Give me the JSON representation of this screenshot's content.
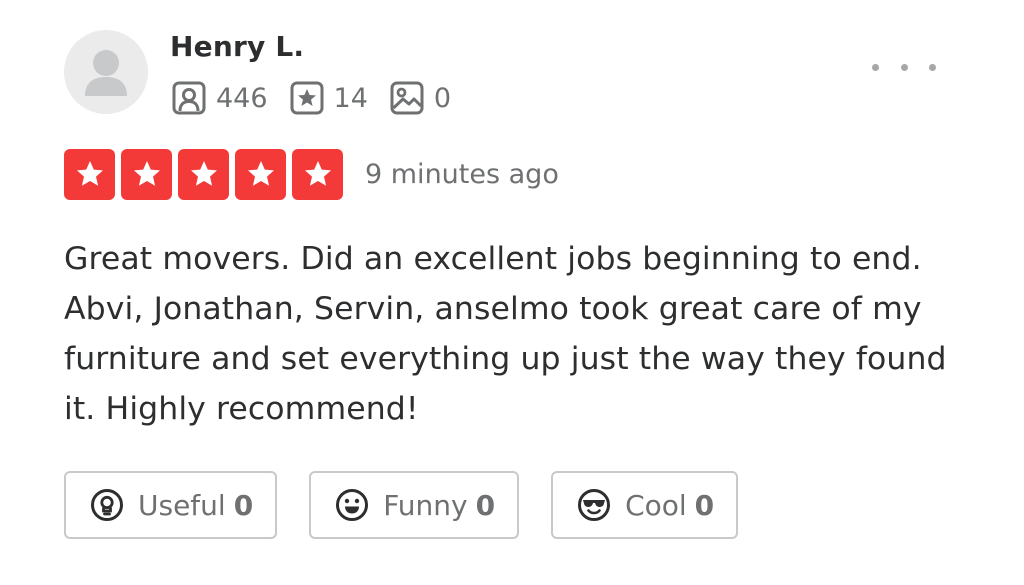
{
  "reviewer": {
    "name": "Henry L.",
    "stats": {
      "friends": "446",
      "reviews": "14",
      "photos": "0"
    },
    "icons": {
      "avatar": "default-user-avatar",
      "friends": "friends-icon",
      "reviews": "review-star-icon",
      "photos": "photo-icon"
    }
  },
  "review": {
    "rating": 5,
    "rating_max": 5,
    "time": "9 minutes ago",
    "text": "Great movers. Did an excellent jobs beginning to end. Abvi, Jonathan, Servin, anselmo took great care of my furniture and set everything up just the way they found it. Highly recommend!"
  },
  "reactions": [
    {
      "label": "Useful",
      "count": "0",
      "icon": "lightbulb-icon"
    },
    {
      "label": "Funny",
      "count": "0",
      "icon": "smiley-face-icon"
    },
    {
      "label": "Cool",
      "count": "0",
      "icon": "sunglasses-face-icon"
    }
  ],
  "colors": {
    "star_fill": "#f43939",
    "text_primary": "#2d2e2f",
    "text_secondary": "#6e7072",
    "button_border": "#c8c9ca"
  },
  "menu": {
    "icon": "more-options-icon"
  }
}
